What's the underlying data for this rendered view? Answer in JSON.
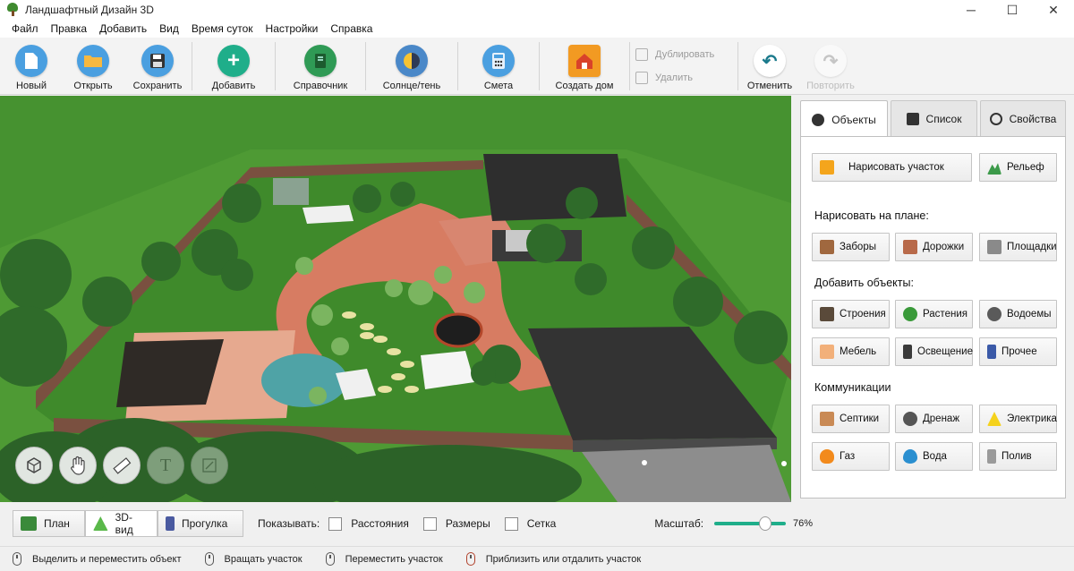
{
  "window": {
    "title": "Ландшафтный Дизайн 3D",
    "minimize": "─",
    "maximize": "☐",
    "close": "✕"
  },
  "menu": [
    "Файл",
    "Правка",
    "Добавить",
    "Вид",
    "Время суток",
    "Настройки",
    "Справка"
  ],
  "toolbar": {
    "new": "Новый",
    "open": "Открыть",
    "save": "Сохранить",
    "add": "Добавить",
    "reference": "Справочник",
    "sun_shadow": "Солнце/тень",
    "estimate": "Смета",
    "create_house": "Создать дом",
    "duplicate": "Дублировать",
    "delete": "Удалить",
    "undo": "Отменить",
    "redo": "Повторить"
  },
  "panel": {
    "tabs": [
      "Объекты",
      "Список",
      "Свойства"
    ],
    "draw_plot": "Нарисовать участок",
    "relief": "Рельеф",
    "draw_on_plan_title": "Нарисовать на плане:",
    "draw_items": [
      "Заборы",
      "Дорожки",
      "Площадки"
    ],
    "add_objects_title": "Добавить объекты:",
    "object_items": [
      "Строения",
      "Растения",
      "Водоемы",
      "Мебель",
      "Освещение",
      "Прочее"
    ],
    "communications_title": "Коммуникации",
    "comm_items": [
      "Септики",
      "Дренаж",
      "Электрика",
      "Газ",
      "Вода",
      "Полив"
    ]
  },
  "viewbar": {
    "modes": [
      "План",
      "3D-вид",
      "Прогулка"
    ],
    "active_mode": "3D-вид",
    "show_label": "Показывать:",
    "checks": [
      "Расстояния",
      "Размеры",
      "Сетка"
    ],
    "scale_label": "Масштаб:",
    "scale_value": "76%",
    "scale_fraction": 0.76
  },
  "status": [
    "Выделить и переместить объект",
    "Вращать участок",
    "Переместить участок",
    "Приблизить или отдалить участок"
  ],
  "colors": {
    "accent": "#2a8fd0",
    "grass": "#4c9a3a",
    "fence": "#7a5040",
    "roof": "#2e2e2e"
  }
}
